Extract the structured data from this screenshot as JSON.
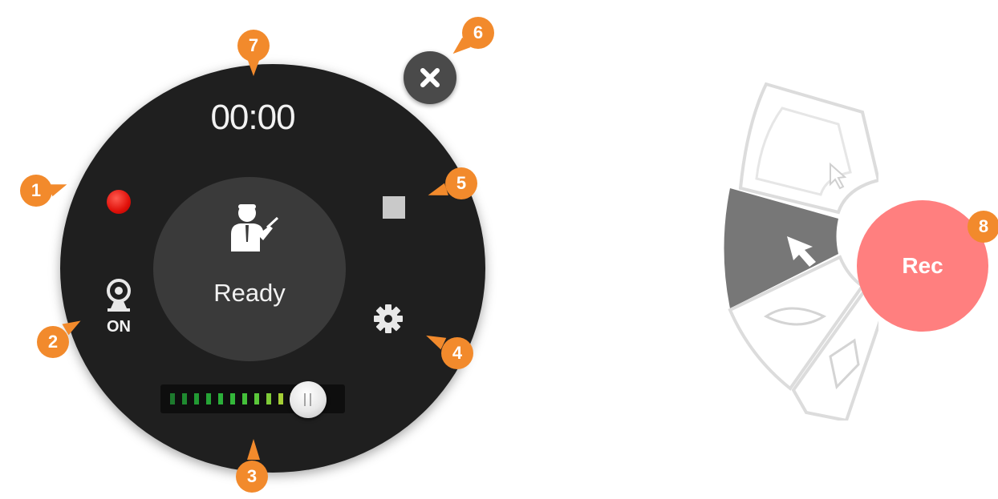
{
  "recorder": {
    "timer": "00:00",
    "status": "Ready",
    "webcam_state": "ON",
    "volume_level": 0.78,
    "meter_segments": 13,
    "meter_colors": [
      "#1d7a2d",
      "#1f8a30",
      "#229a33",
      "#26a436",
      "#2bb03a",
      "#34b83a",
      "#44c03a",
      "#5ac73a",
      "#7ecb38",
      "#a5cf36",
      "#c9c535",
      "#e0b030",
      "#f1a01e"
    ],
    "record_color": "#e0110a"
  },
  "callouts": [
    "1",
    "2",
    "3",
    "4",
    "5",
    "6",
    "7",
    "8"
  ],
  "tool_menu": {
    "rec_label": "Rec",
    "rec_color": "#ff7f7f",
    "active_tool": "arrow-pointer"
  },
  "icons": {
    "record": "record-dot-icon",
    "stop": "stop-square-icon",
    "webcam": "webcam-icon",
    "settings": "gear-icon",
    "close": "close-icon",
    "presenter": "presenter-icon"
  }
}
